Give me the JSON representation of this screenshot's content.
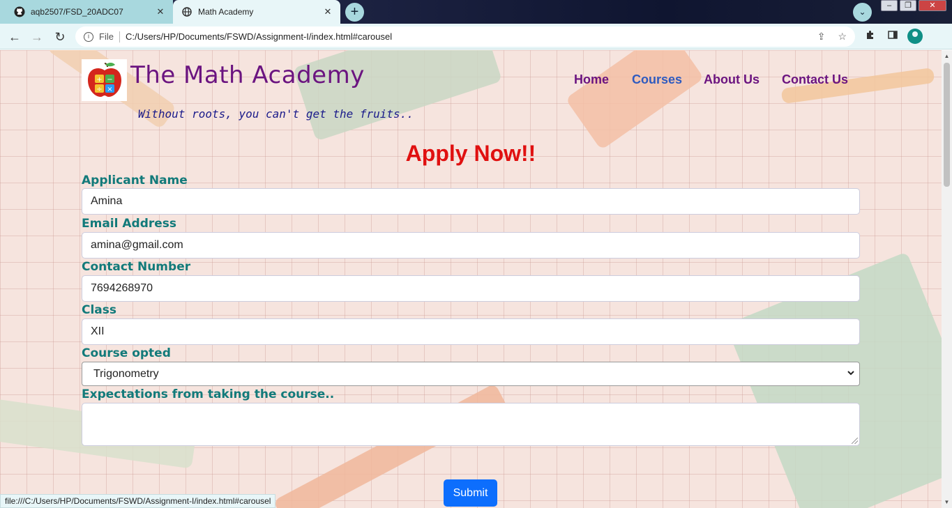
{
  "browser": {
    "tabs": [
      {
        "title": "aqb2507/FSD_20ADC07",
        "icon": "github-icon"
      },
      {
        "title": "Math Academy",
        "icon": "globe-icon"
      }
    ],
    "address": {
      "scheme": "File",
      "url": "C:/Users/HP/Documents/FSWD/Assignment-I/index.html#carousel"
    },
    "status_url": "file:///C:/Users/HP/Documents/FSWD/Assignment-I/index.html#carousel"
  },
  "header": {
    "brand": "The Math Academy",
    "tagline": "Without roots, you can't get the fruits..",
    "nav": [
      "Home",
      "Courses",
      "About Us",
      "Contact Us"
    ],
    "active_nav": "Courses"
  },
  "form": {
    "heading": "Apply Now!!",
    "fields": {
      "name": {
        "label": "Applicant Name",
        "value": "Amina"
      },
      "email": {
        "label": "Email Address",
        "value": "amina@gmail.com"
      },
      "contact": {
        "label": "Contact Number",
        "value": "7694268970"
      },
      "class": {
        "label": "Class",
        "value": "XII"
      },
      "course": {
        "label": "Course opted",
        "value": "Trigonometry"
      },
      "expectations": {
        "label": "Expectations from taking the course..",
        "value": ""
      }
    },
    "submit_label": "Submit"
  },
  "colors": {
    "brand": "#6b1480",
    "label": "#127a7a",
    "heading": "#e01010",
    "submit": "#0d6efd"
  }
}
